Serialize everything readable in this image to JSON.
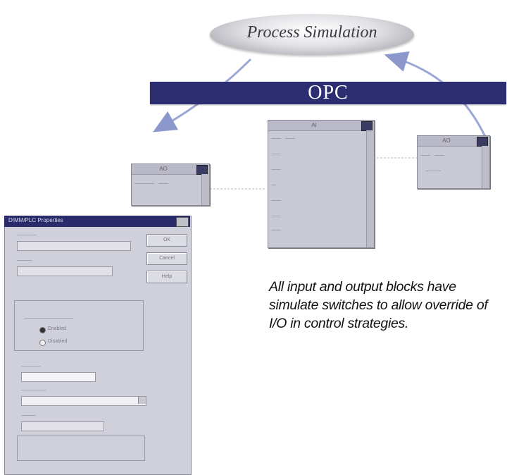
{
  "diagram": {
    "top_node": "Process Simulation",
    "bar_label": "OPC",
    "caption": "All input and output blocks have simulate switches to allow override of I/O in control strategies."
  },
  "windows": {
    "center_title": "AI",
    "left_title": "AO",
    "right_title": "AO",
    "dialog_title": "DIMM/PLC Properties"
  },
  "dialog": {
    "ok_label": "OK",
    "cancel_label": "Cancel",
    "help_label": "Help",
    "enable_label": "Enabled",
    "disable_label": "Disabled"
  },
  "colors": {
    "opc_bar": "#2d2e72",
    "window_bg": "#c9c9d3",
    "dialog_title": "#2a2b6a",
    "arrow": "#9aa6d6"
  }
}
